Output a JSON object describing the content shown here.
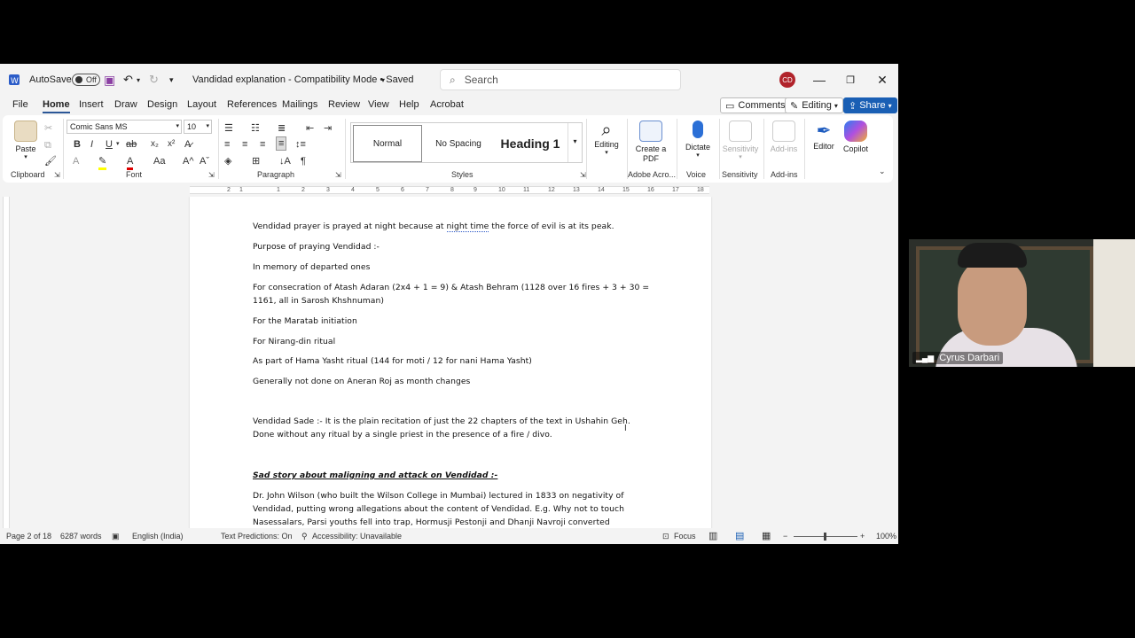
{
  "titlebar": {
    "autosave_label": "AutoSave",
    "autosave_state": "Off",
    "doc_title": "Vandidad explanation - Compatibility Mode • Saved",
    "search_placeholder": "Search",
    "user_initials": "CD"
  },
  "menubar": {
    "items": [
      "File",
      "Home",
      "Insert",
      "Draw",
      "Design",
      "Layout",
      "References",
      "Mailings",
      "Review",
      "View",
      "Help",
      "Acrobat"
    ],
    "comments_label": "Comments",
    "editing_label": "Editing",
    "share_label": "Share"
  },
  "ribbon": {
    "paste_label": "Paste",
    "font_name": "Comic Sans MS",
    "font_size": "10",
    "styles": [
      "Normal",
      "No Spacing",
      "Heading 1"
    ],
    "editing_label": "Editing",
    "create_pdf_label": "Create a PDF",
    "dictate_label": "Dictate",
    "sensitivity_label": "Sensitivity",
    "addins_label": "Add-ins",
    "editor_label": "Editor",
    "copilot_label": "Copilot",
    "groups": [
      "Clipboard",
      "Font",
      "Paragraph",
      "Styles",
      "Adobe Acro...",
      "Voice",
      "Sensitivity",
      "Add-ins"
    ]
  },
  "ruler": {
    "ticks": [
      "2",
      "1",
      "1",
      "2",
      "3",
      "4",
      "5",
      "6",
      "7",
      "8",
      "9",
      "10",
      "11",
      "12",
      "13",
      "14",
      "15",
      "16",
      "17",
      "18"
    ]
  },
  "document": {
    "lines": [
      "Vendidad prayer is prayed at night because at night time the force of evil is at its peak.",
      "Purpose of praying Vendidad :-",
      "In memory of departed ones",
      "For consecration of Atash Adaran (2x4 + 1 = 9) & Atash Behram (1128 over 16 fires + 3 + 30 =",
      "1161, all in Sarosh Khshnuman)",
      "For the Maratab initiation",
      "For Nirang-din ritual",
      "As part of Hama Yasht ritual (144 for moti / 12 for nani Hama Yasht)",
      "Generally not done on Aneran Roj as month changes",
      "Vendidad Sade :- It is the plain recitation of just the 22 chapters of the text in Ushahin Geh.",
      "Done without any ritual by a single priest in the presence of a fire / divo.",
      "Sad story about maligning and attack on Vendidad :-",
      "Dr. John Wilson (who built the Wilson College in Mumbai) lectured in 1833 on negativity of",
      "Vendidad, putting wrong allegations about the content of Vendidad. E.g. Why not to touch",
      "Nasessalars, Parsi youths fell into trap, Hormusji Pestonji and Dhanji Navroji converted"
    ]
  },
  "statusbar": {
    "page": "Page 2 of 18",
    "words": "6287 words",
    "language": "English (India)",
    "text_predictions": "Text Predictions: On",
    "accessibility": "Accessibility: Unavailable",
    "focus": "Focus",
    "zoom": "100%"
  },
  "webcam": {
    "participant_name": "Cyrus Darbari"
  }
}
